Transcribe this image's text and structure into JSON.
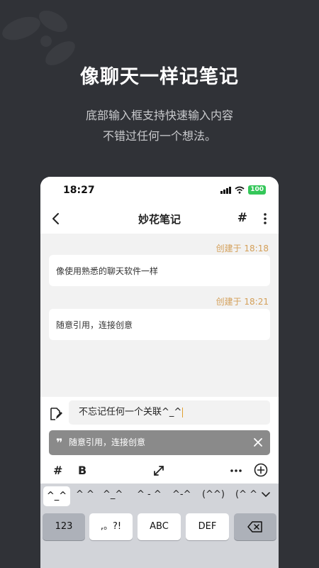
{
  "promo": {
    "title": "像聊天一样记笔记",
    "subtitle_line1": "底部输入框支持快速输入内容",
    "subtitle_line2": "不错过任何一个想法。"
  },
  "status_bar": {
    "time": "18:27",
    "battery": "100"
  },
  "nav": {
    "title": "妙花笔记",
    "tag_icon": "#"
  },
  "notes": [
    {
      "created": "创建于 18:18",
      "content": "像使用熟悉的聊天软件一样"
    },
    {
      "created": "创建于 18:21",
      "content": "随意引用，连接创意"
    }
  ],
  "composer": {
    "input_value": "不忘记任何一个关联^_^",
    "quote_text": "随意引用，连接创意",
    "toolbar": {
      "hash": "#",
      "bold": "B"
    }
  },
  "keyboard": {
    "suggestions": [
      "^_^",
      "^ ^",
      "^_^",
      "^ - ^",
      "^-^",
      "(^^)",
      "(^ ^"
    ],
    "keys": [
      "123",
      ",。?!",
      "ABC",
      "DEF"
    ]
  },
  "colors": {
    "background": "#303237",
    "accent": "#d4a05a",
    "battery": "#34c759"
  }
}
